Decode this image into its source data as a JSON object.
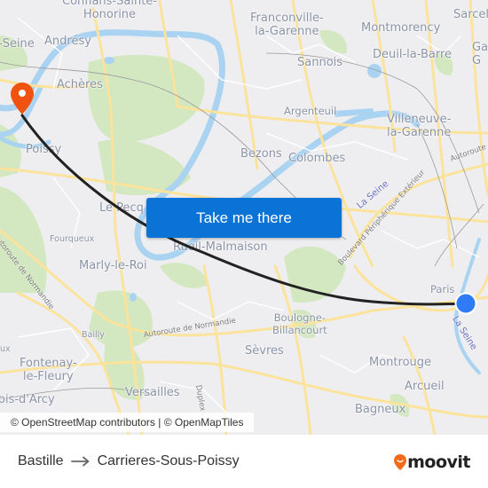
{
  "map": {
    "places": [
      {
        "name": "Conflans-Sainte-Honorine",
        "lines": [
          "Conflans-Sainte-",
          "Honorine"
        ]
      },
      {
        "name": "Andrésy",
        "lines": [
          "Andrésy"
        ]
      },
      {
        "name": "-Seine",
        "lines": [
          "-Seine"
        ]
      },
      {
        "name": "Achères",
        "lines": [
          "Achères"
        ]
      },
      {
        "name": "Poissy",
        "lines": [
          "Poissy"
        ]
      },
      {
        "name": "Franconville-la-Garenne",
        "lines": [
          "Franconville-",
          "la-Garenne"
        ]
      },
      {
        "name": "Montmorency",
        "lines": [
          "Montmorency"
        ]
      },
      {
        "name": "Sarcelles",
        "lines": [
          "Sarcel"
        ]
      },
      {
        "name": "Deuil-la-Barre",
        "lines": [
          "Deuil-la-Barre"
        ]
      },
      {
        "name": "Ga",
        "lines": [
          "Ga",
          "G"
        ]
      },
      {
        "name": "Sannois",
        "lines": [
          "Sannois"
        ]
      },
      {
        "name": "Argenteuil",
        "lines": [
          "Argenteuil"
        ]
      },
      {
        "name": "Villeneuve-la-Garenne",
        "lines": [
          "Villeneuve-",
          "la-Garenne"
        ]
      },
      {
        "name": "Bezons",
        "lines": [
          "Bezons"
        ]
      },
      {
        "name": "Colombes",
        "lines": [
          "Colombes"
        ]
      },
      {
        "name": "Le Pecq",
        "lines": [
          "Le Pecq"
        ]
      },
      {
        "name": "Fourqueux",
        "lines": [
          "Fourqueux"
        ]
      },
      {
        "name": "Rueil-Malmaison",
        "lines": [
          "Rueil-Malmaison"
        ]
      },
      {
        "name": "Marly-le-Roi",
        "lines": [
          "Marly-le-Roi"
        ]
      },
      {
        "name": "Bailly",
        "lines": [
          "Bailly"
        ]
      },
      {
        "name": "ux",
        "lines": [
          "ux"
        ]
      },
      {
        "name": "Fontenay-le-Fleury",
        "lines": [
          "Fontenay-",
          "le-Fleury"
        ]
      },
      {
        "name": "Bois-d'Arcy",
        "lines": [
          "ois-d'Arcy"
        ]
      },
      {
        "name": "Versailles",
        "lines": [
          "Versailles"
        ]
      },
      {
        "name": "Paris",
        "lines": [
          "Paris"
        ]
      },
      {
        "name": "Boulogne-Billancourt",
        "lines": [
          "Boulogne-",
          "Billancourt"
        ]
      },
      {
        "name": "Sèvres",
        "lines": [
          "Sèvres"
        ]
      },
      {
        "name": "Montrouge",
        "lines": [
          "Montrouge"
        ]
      },
      {
        "name": "Arcueil",
        "lines": [
          "Arcueil"
        ]
      },
      {
        "name": "Bagneux",
        "lines": [
          "Bagneux"
        ]
      }
    ],
    "road_labels": [
      "Autoroute de Normandie",
      "Autoroute de Normandie",
      "Boulevard Périphérique Extérieur",
      "Autoroute",
      "Duplex"
    ],
    "water_labels": [
      "La Seine",
      "La Seine"
    ],
    "origin": "Bastille",
    "destination": "Carrieres-Sous-Poissy",
    "colors": {
      "route": "#222222",
      "origin_marker": "#2f7bf5",
      "destination_marker": "#f0520f",
      "water": "#aad3f2",
      "park": "#cfe5b8",
      "road": "#fce6a0",
      "land": "#eeeef0"
    }
  },
  "cta": {
    "label": "Take me there"
  },
  "attribution": "© OpenStreetMap contributors | © OpenMapTiles",
  "footer": {
    "from": "Bastille",
    "to": "Carrieres-Sous-Poissy",
    "arrow_icon": "right-arrow-icon",
    "brand": "moovit",
    "brand_color": "#f26a1b"
  }
}
